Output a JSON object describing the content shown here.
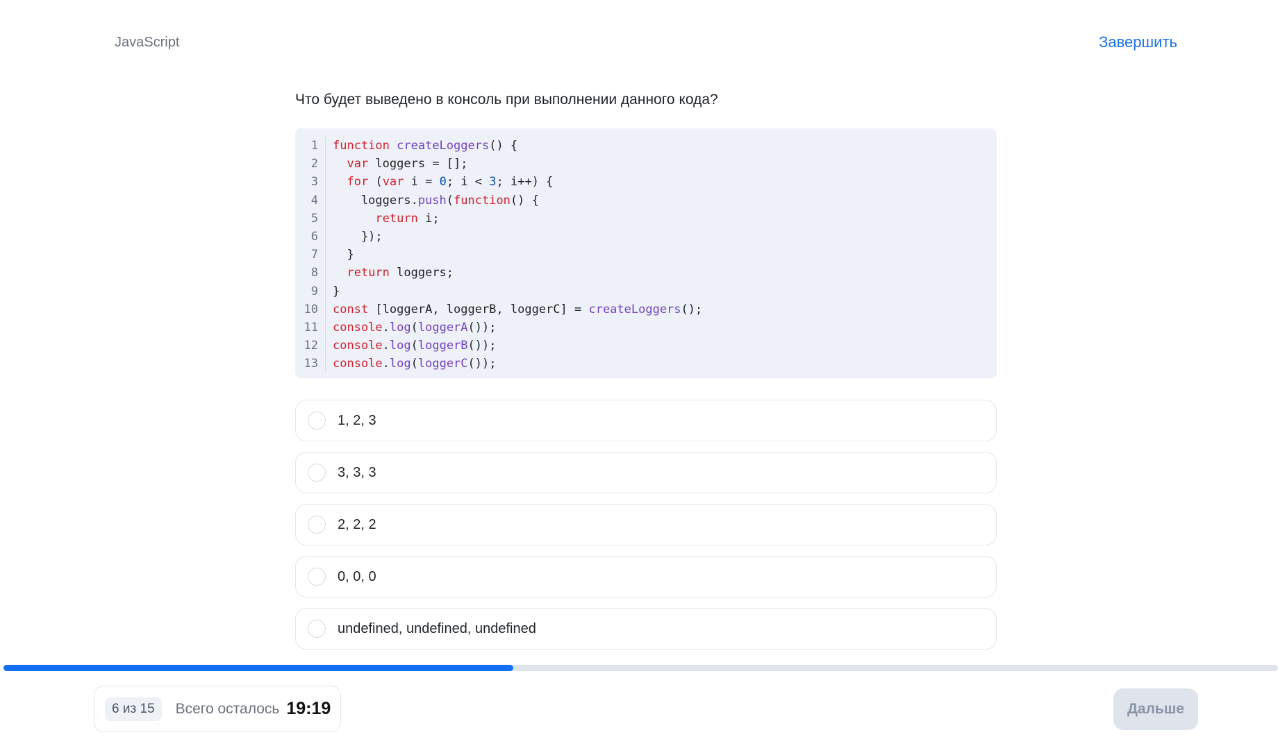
{
  "header": {
    "topic": "JavaScript",
    "finish_label": "Завершить"
  },
  "question": {
    "text": "Что будет выведено в консоль при выполнении данного кода?"
  },
  "code": {
    "language": "javascript",
    "lines": [
      "function createLoggers() {",
      "  var loggers = [];",
      "  for (var i = 0; i < 3; i++) {",
      "    loggers.push(function() {",
      "      return i;",
      "    });",
      "  }",
      "  return loggers;",
      "}",
      "const [loggerA, loggerB, loggerC] = createLoggers();",
      "console.log(loggerA());",
      "console.log(loggerB());",
      "console.log(loggerC());"
    ]
  },
  "options": [
    {
      "label": "1, 2, 3"
    },
    {
      "label": "3, 3, 3"
    },
    {
      "label": "2, 2, 2"
    },
    {
      "label": "0, 0, 0"
    },
    {
      "label": "undefined, undefined, undefined"
    }
  ],
  "progress": {
    "fraction": 0.4,
    "color": "#1570ef",
    "track_color": "#dfe3ea"
  },
  "footer": {
    "counter": "6 из 15",
    "remaining_label": "Всего осталось",
    "timer": "19:19",
    "next_label": "Дальше"
  },
  "colors": {
    "accent": "#1a73e8",
    "code_background": "#eef1f7",
    "keyword": "#cf222e",
    "function": "#6f42c1",
    "number": "#0550ae"
  }
}
